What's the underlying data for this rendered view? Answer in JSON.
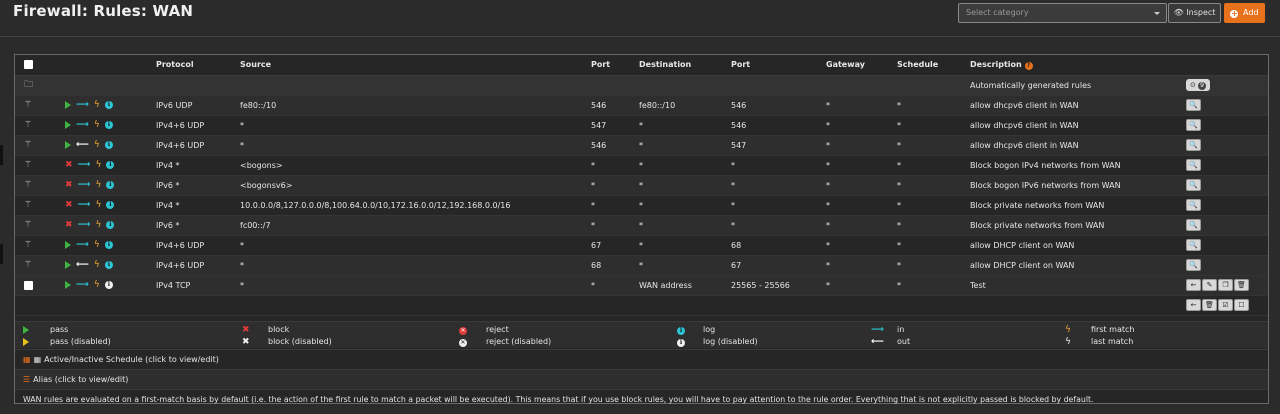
{
  "page": {
    "title": "Firewall: Rules: WAN"
  },
  "header": {
    "category_placeholder": "Select category",
    "inspect_label": "Inspect",
    "add_label": "Add"
  },
  "table": {
    "headers": {
      "protocol": "Protocol",
      "source": "Source",
      "src_port": "Port",
      "destination": "Destination",
      "dst_port": "Port",
      "gateway": "Gateway",
      "schedule": "Schedule",
      "description": "Description"
    },
    "auto_row": {
      "description": "Automatically generated rules",
      "count": "9"
    },
    "rows": [
      {
        "action": "pass",
        "direction": "in",
        "log": "log",
        "protocol": "IPv6 UDP",
        "source": "fe80::/10",
        "src_port": "546",
        "destination": "fe80::/10",
        "dst_port": "546",
        "gateway": "*",
        "schedule": "*",
        "description": "allow dhcpv6 client in WAN"
      },
      {
        "action": "pass",
        "direction": "in",
        "log": "log",
        "protocol": "IPv4+6 UDP",
        "source": "*",
        "src_port": "547",
        "destination": "*",
        "dst_port": "546",
        "gateway": "*",
        "schedule": "*",
        "description": "allow dhcpv6 client in WAN"
      },
      {
        "action": "pass",
        "direction": "out",
        "log": "log",
        "protocol": "IPv4+6 UDP",
        "source": "*",
        "src_port": "546",
        "destination": "*",
        "dst_port": "547",
        "gateway": "*",
        "schedule": "*",
        "description": "allow dhcpv6 client in WAN"
      },
      {
        "action": "block",
        "direction": "in",
        "log": "log",
        "protocol": "IPv4 *",
        "source": "<bogons>",
        "src_port": "*",
        "destination": "*",
        "dst_port": "*",
        "gateway": "*",
        "schedule": "*",
        "description": "Block bogon IPv4 networks from WAN"
      },
      {
        "action": "block",
        "direction": "in",
        "log": "log",
        "protocol": "IPv6 *",
        "source": "<bogonsv6>",
        "src_port": "*",
        "destination": "*",
        "dst_port": "*",
        "gateway": "*",
        "schedule": "*",
        "description": "Block bogon IPv6 networks from WAN"
      },
      {
        "action": "block",
        "direction": "in",
        "log": "log",
        "protocol": "IPv4 *",
        "source": "10.0.0.0/8,127.0.0.0/8,100.64.0.0/10,172.16.0.0/12,192.168.0.0/16",
        "src_port": "*",
        "destination": "*",
        "dst_port": "*",
        "gateway": "*",
        "schedule": "*",
        "description": "Block private networks from WAN"
      },
      {
        "action": "block",
        "direction": "in",
        "log": "log",
        "protocol": "IPv6 *",
        "source": "fc00::/7",
        "src_port": "*",
        "destination": "*",
        "dst_port": "*",
        "gateway": "*",
        "schedule": "*",
        "description": "Block private networks from WAN"
      },
      {
        "action": "pass",
        "direction": "in",
        "log": "log",
        "protocol": "IPv4+6 UDP",
        "source": "*",
        "src_port": "67",
        "destination": "*",
        "dst_port": "68",
        "gateway": "*",
        "schedule": "*",
        "description": "allow DHCP client on WAN"
      },
      {
        "action": "pass",
        "direction": "out",
        "log": "log",
        "protocol": "IPv4+6 UDP",
        "source": "*",
        "src_port": "68",
        "destination": "*",
        "dst_port": "67",
        "gateway": "*",
        "schedule": "*",
        "description": "allow DHCP client on WAN"
      }
    ],
    "user_row": {
      "protocol": "IPv4 TCP",
      "source": "*",
      "src_port": "*",
      "destination": "WAN address",
      "dst_port": "25565 - 25566",
      "gateway": "*",
      "schedule": "*",
      "description": "Test"
    }
  },
  "legend": {
    "pass": "pass",
    "pass_disabled": "pass (disabled)",
    "block": "block",
    "block_disabled": "block (disabled)",
    "reject": "reject",
    "reject_disabled": "reject (disabled)",
    "log": "log",
    "log_disabled": "log (disabled)",
    "in": "in",
    "out": "out",
    "first_match": "first match",
    "last_match": "last match"
  },
  "notes": {
    "schedule": "Active/Inactive Schedule (click to view/edit)",
    "alias": "Alias (click to view/edit)",
    "wan_info": "WAN rules are evaluated on a first-match basis by default (i.e. the action of the first rule to match a packet will be executed). This means that if you use block rules, you will have to pay attention to the rule order. Everything that is not explicitly passed is blocked by default."
  }
}
